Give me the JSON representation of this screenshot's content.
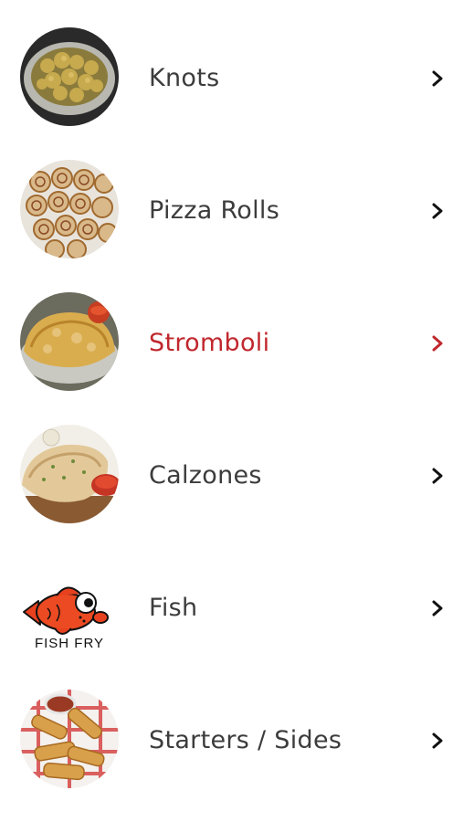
{
  "menu": {
    "items": [
      {
        "label": "Knots",
        "image": "garlic-knots-image",
        "chevron": "chevron-right-icon",
        "active": false
      },
      {
        "label": "Pizza Rolls",
        "image": "pizza-rolls-image",
        "chevron": "chevron-right-icon",
        "active": false
      },
      {
        "label": "Stromboli",
        "image": "stromboli-image",
        "chevron": "chevron-right-icon",
        "active": true
      },
      {
        "label": "Calzones",
        "image": "calzones-image",
        "chevron": "chevron-right-icon",
        "active": false
      },
      {
        "label": "Fish",
        "image": "fish-fry-image",
        "image_caption": "FISH FRY",
        "chevron": "chevron-right-icon",
        "active": false
      },
      {
        "label": "Starters / Sides",
        "image": "starters-sides-image",
        "chevron": "chevron-right-icon",
        "active": false
      }
    ]
  },
  "colors": {
    "text": "#3c3c3c",
    "active": "#c0272d",
    "chevron": "#111111",
    "background": "#ffffff"
  }
}
